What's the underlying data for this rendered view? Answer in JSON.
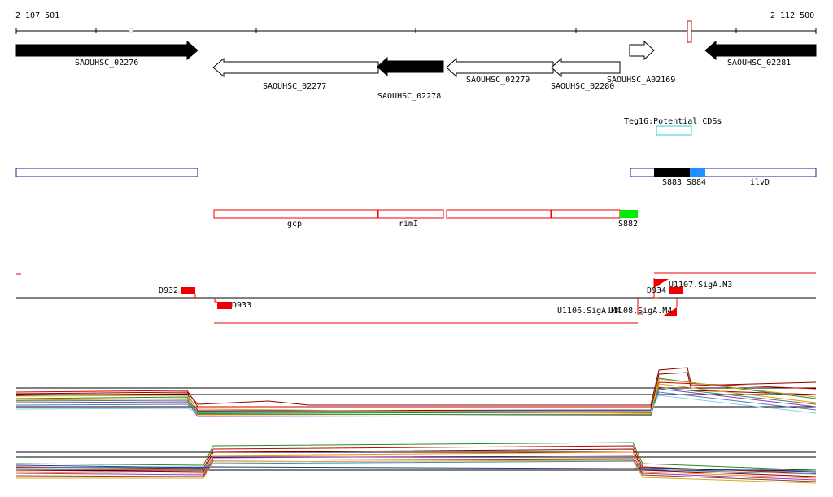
{
  "coords": {
    "start": "2 107 501",
    "end": "2 112 500"
  },
  "genes": [
    {
      "id": "SAOUHSC_02276",
      "strand": "+",
      "fill": "#000000"
    },
    {
      "id": "SAOUHSC_02277",
      "strand": "-",
      "fill": "#ffffff"
    },
    {
      "id": "SAOUHSC_02278",
      "strand": "-",
      "fill": "#000000"
    },
    {
      "id": "SAOUHSC_02279",
      "strand": "-",
      "fill": "#ffffff"
    },
    {
      "id": "SAOUHSC_02280",
      "strand": "-",
      "fill": "#ffffff"
    },
    {
      "id": "SAOUHSC_A02169",
      "strand": "+",
      "fill": "#ffffff"
    },
    {
      "id": "SAOUHSC_02281",
      "strand": "+",
      "fill": "#000000"
    }
  ],
  "potential_cds": {
    "label": "Teg16:Potential CDSs"
  },
  "blue_track": {
    "labels": [
      "S883",
      "S884",
      "ilvD"
    ]
  },
  "red_track": {
    "labels": [
      "gcp",
      "rimI",
      "S882"
    ]
  },
  "features": {
    "labels": [
      "D932",
      "D933",
      "D934",
      "U1107.SigA.M3",
      "U1106.SigA.M4",
      "U1108.SigA.M4"
    ]
  },
  "colors": {
    "gene_outline": "#000000",
    "red_feature": "#ff0000",
    "blue_outline": "#1c1c9c",
    "cyan": "#33cccc",
    "green": "#00ee00",
    "light_blue": "#1e90ff"
  }
}
